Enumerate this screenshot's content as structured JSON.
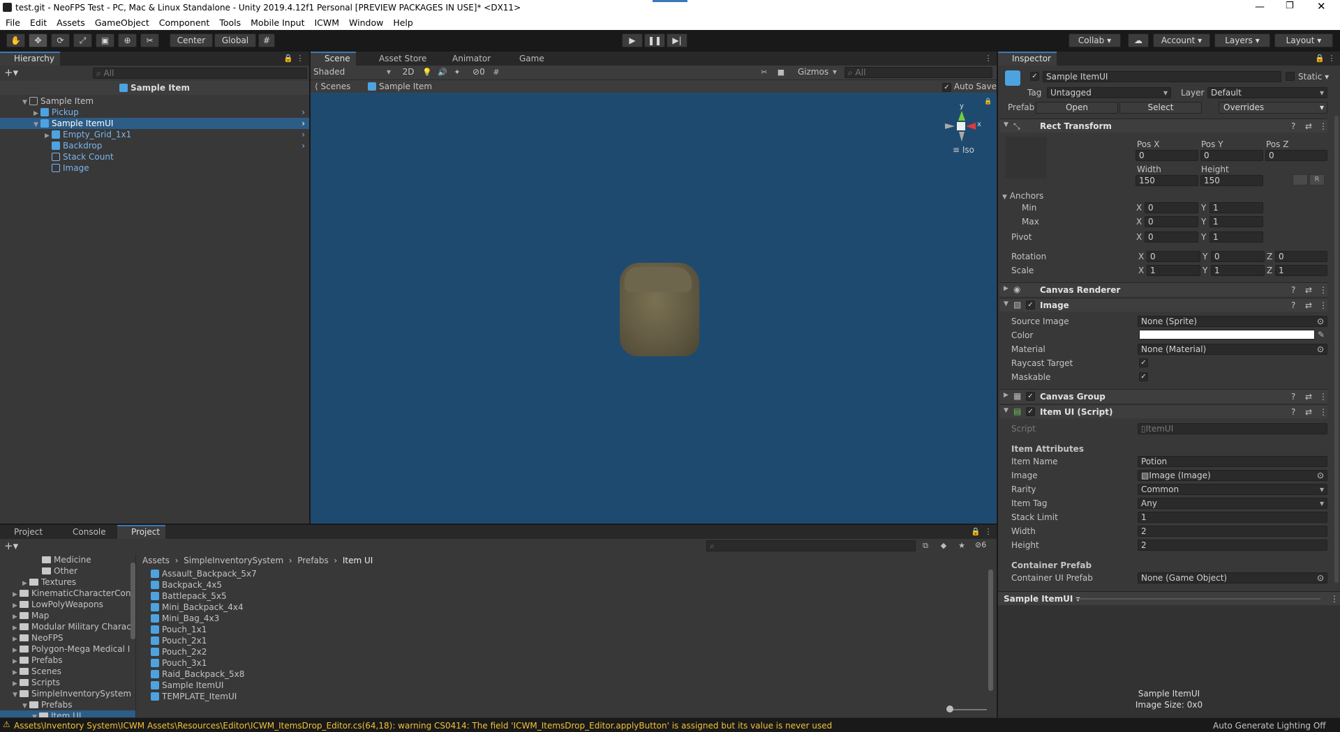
{
  "window": {
    "title": "test.git - NeoFPS Test - PC, Mac & Linux Standalone - Unity 2019.4.12f1 Personal [PREVIEW PACKAGES IN USE]* <DX11>"
  },
  "menu": [
    "File",
    "Edit",
    "Assets",
    "GameObject",
    "Component",
    "Tools",
    "Mobile Input",
    "ICWM",
    "Window",
    "Help"
  ],
  "toolbar": {
    "center": "Center",
    "global": "Global",
    "collab": "Collab",
    "account": "Account",
    "layers": "Layers",
    "layout": "Layout"
  },
  "hierarchy": {
    "tab": "Hierarchy",
    "search": "All",
    "scene_title": "Sample Item",
    "items": [
      "Sample Item",
      "Pickup",
      "Sample ItemUI",
      "Empty_Grid_1x1",
      "Backdrop",
      "Stack Count",
      "Image"
    ]
  },
  "scene": {
    "tabs": [
      "Scene",
      "Asset Store",
      "Animator",
      "Game"
    ],
    "shading": "Shaded",
    "mode2d": "2D",
    "hidden_count": "0",
    "gizmos": "Gizmos",
    "search": "All",
    "breadcrumb_scenes": "Scenes",
    "breadcrumb_item": "Sample Item",
    "autosave": "Auto Save",
    "iso": "Iso",
    "axis_y": "y",
    "axis_x": "x"
  },
  "project": {
    "tabs": [
      "Project",
      "Console",
      "Project"
    ],
    "count": "6",
    "breadcrumb": [
      "Assets",
      "SimpleInventorySystem",
      "Prefabs",
      "Item UI"
    ],
    "tree": [
      "Medicine",
      "Other",
      "Textures",
      "KinematicCharacterCont",
      "LowPolyWeapons",
      "Map",
      "Modular Military Charact",
      "NeoFPS",
      "Polygon-Mega Medical I",
      "Prefabs",
      "Scenes",
      "Scripts",
      "SimpleInventorySystem",
      "Prefabs",
      "Item UI"
    ],
    "assets": [
      "Assault_Backpack_5x7",
      "Backpack_4x5",
      "Battlepack_5x5",
      "Mini_Backpack_4x4",
      "Mini_Bag_4x3",
      "Pouch_1x1",
      "Pouch_2x1",
      "Pouch_2x2",
      "Pouch_3x1",
      "Raid_Backpack_5x8",
      "Sample ItemUI",
      "TEMPLATE_ItemUI"
    ]
  },
  "inspector": {
    "tab": "Inspector",
    "name": "Sample ItemUI",
    "static": "Static",
    "tag_label": "Tag",
    "tag": "Untagged",
    "layer_label": "Layer",
    "layer": "Default",
    "prefab_label": "Prefab",
    "open": "Open",
    "select": "Select",
    "overrides": "Overrides",
    "rect": {
      "title": "Rect Transform",
      "posx_l": "Pos X",
      "posy_l": "Pos Y",
      "posz_l": "Pos Z",
      "posx": "0",
      "posy": "0",
      "posz": "0",
      "width_l": "Width",
      "height_l": "Height",
      "width": "150",
      "height": "150",
      "anchors": "Anchors",
      "min": "Min",
      "max": "Max",
      "pivot": "Pivot",
      "min_x": "0",
      "min_y": "1",
      "max_x": "0",
      "max_y": "1",
      "pivot_x": "0",
      "pivot_y": "1",
      "rotation": "Rotation",
      "scale": "Scale",
      "rot_x": "0",
      "rot_y": "0",
      "rot_z": "0",
      "sc_x": "1",
      "sc_y": "1",
      "sc_z": "1",
      "x": "X",
      "y": "Y",
      "z": "Z",
      "raw": "R"
    },
    "canvas_renderer": "Canvas Renderer",
    "image": {
      "title": "Image",
      "source_l": "Source Image",
      "source": "None (Sprite)",
      "color_l": "Color",
      "material_l": "Material",
      "material": "None (Material)",
      "raycast_l": "Raycast Target",
      "maskable_l": "Maskable",
      "check": "✓"
    },
    "canvas_group": "Canvas Group",
    "itemui": {
      "title": "Item UI (Script)",
      "script_l": "Script",
      "script": "ItemUI",
      "attrs": "Item Attributes",
      "name_l": "Item Name",
      "name": "Potion",
      "image_l": "Image",
      "image": "Image (Image)",
      "rarity_l": "Rarity",
      "rarity": "Common",
      "tag_l": "Item Tag",
      "tag": "Any",
      "stack_l": "Stack Limit",
      "stack": "1",
      "w_l": "Width",
      "w": "2",
      "h_l": "Height",
      "h": "2",
      "container": "Container Prefab",
      "cui_l": "Container UI Prefab",
      "cui": "None (Game Object)"
    },
    "preview_title": "Sample ItemUI",
    "preview_name": "Sample ItemUI",
    "preview_size": "Image Size: 0x0"
  },
  "status": {
    "warning": "Assets\\Inventory System\\ICWM Assets\\Resources\\Editor\\ICWM_ItemsDrop_Editor.cs(64,18): warning CS0414: The field 'ICWM_ItemsDrop_Editor.applyButton' is assigned but its value is never used",
    "lighting": "Auto Generate Lighting Off"
  },
  "colors": {
    "scene_bg": "#1f4a70",
    "selection": "#2c5d87",
    "accent": "#3a79bb",
    "warning": "#f2c237"
  }
}
